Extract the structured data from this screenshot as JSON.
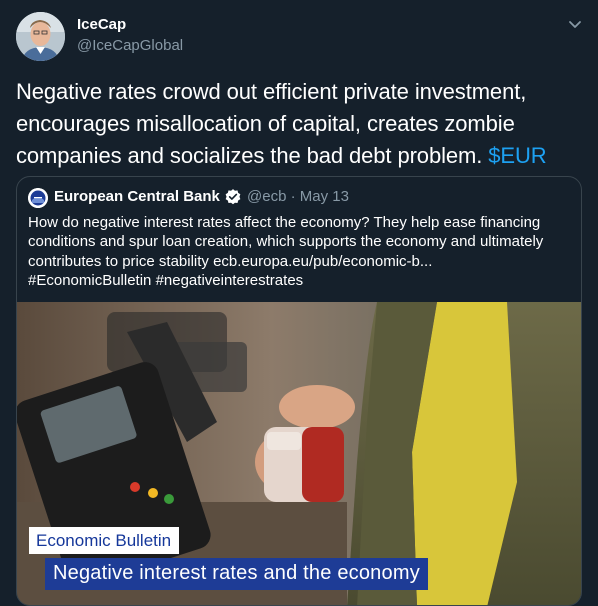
{
  "tweet": {
    "author_name": "IceCap",
    "author_handle": "@IceCapGlobal",
    "text": "Negative rates crowd out efficient private investment, encourages misallocation of capital, creates zombie companies and socializes the bad debt problem.",
    "cashtag": "$EUR"
  },
  "quoted": {
    "author_name": "European Central Bank",
    "author_handle": "@ecb",
    "separator": "·",
    "date": "May 13",
    "text_line1": "How do negative interest rates affect the economy? They help ease financing",
    "text_line2": "conditions and spur loan creation, which supports the economy and ultimately",
    "text_line3": "contributes to price stability ecb.europa.eu/pub/economic-b...",
    "text_line4": "#EconomicBulletin #negativeinterestrates",
    "media": {
      "banner_small": "Economic Bulletin",
      "banner_big": "Negative interest rates and the economy"
    }
  },
  "colors": {
    "background": "#15202b",
    "link": "#1da1f2",
    "muted": "#8899a6",
    "border": "#38444d",
    "ecb_blue": "#1e3c96"
  },
  "icons": [
    "avatar",
    "chevron-down-icon",
    "ecb-logo-icon",
    "verified-badge-icon"
  ]
}
